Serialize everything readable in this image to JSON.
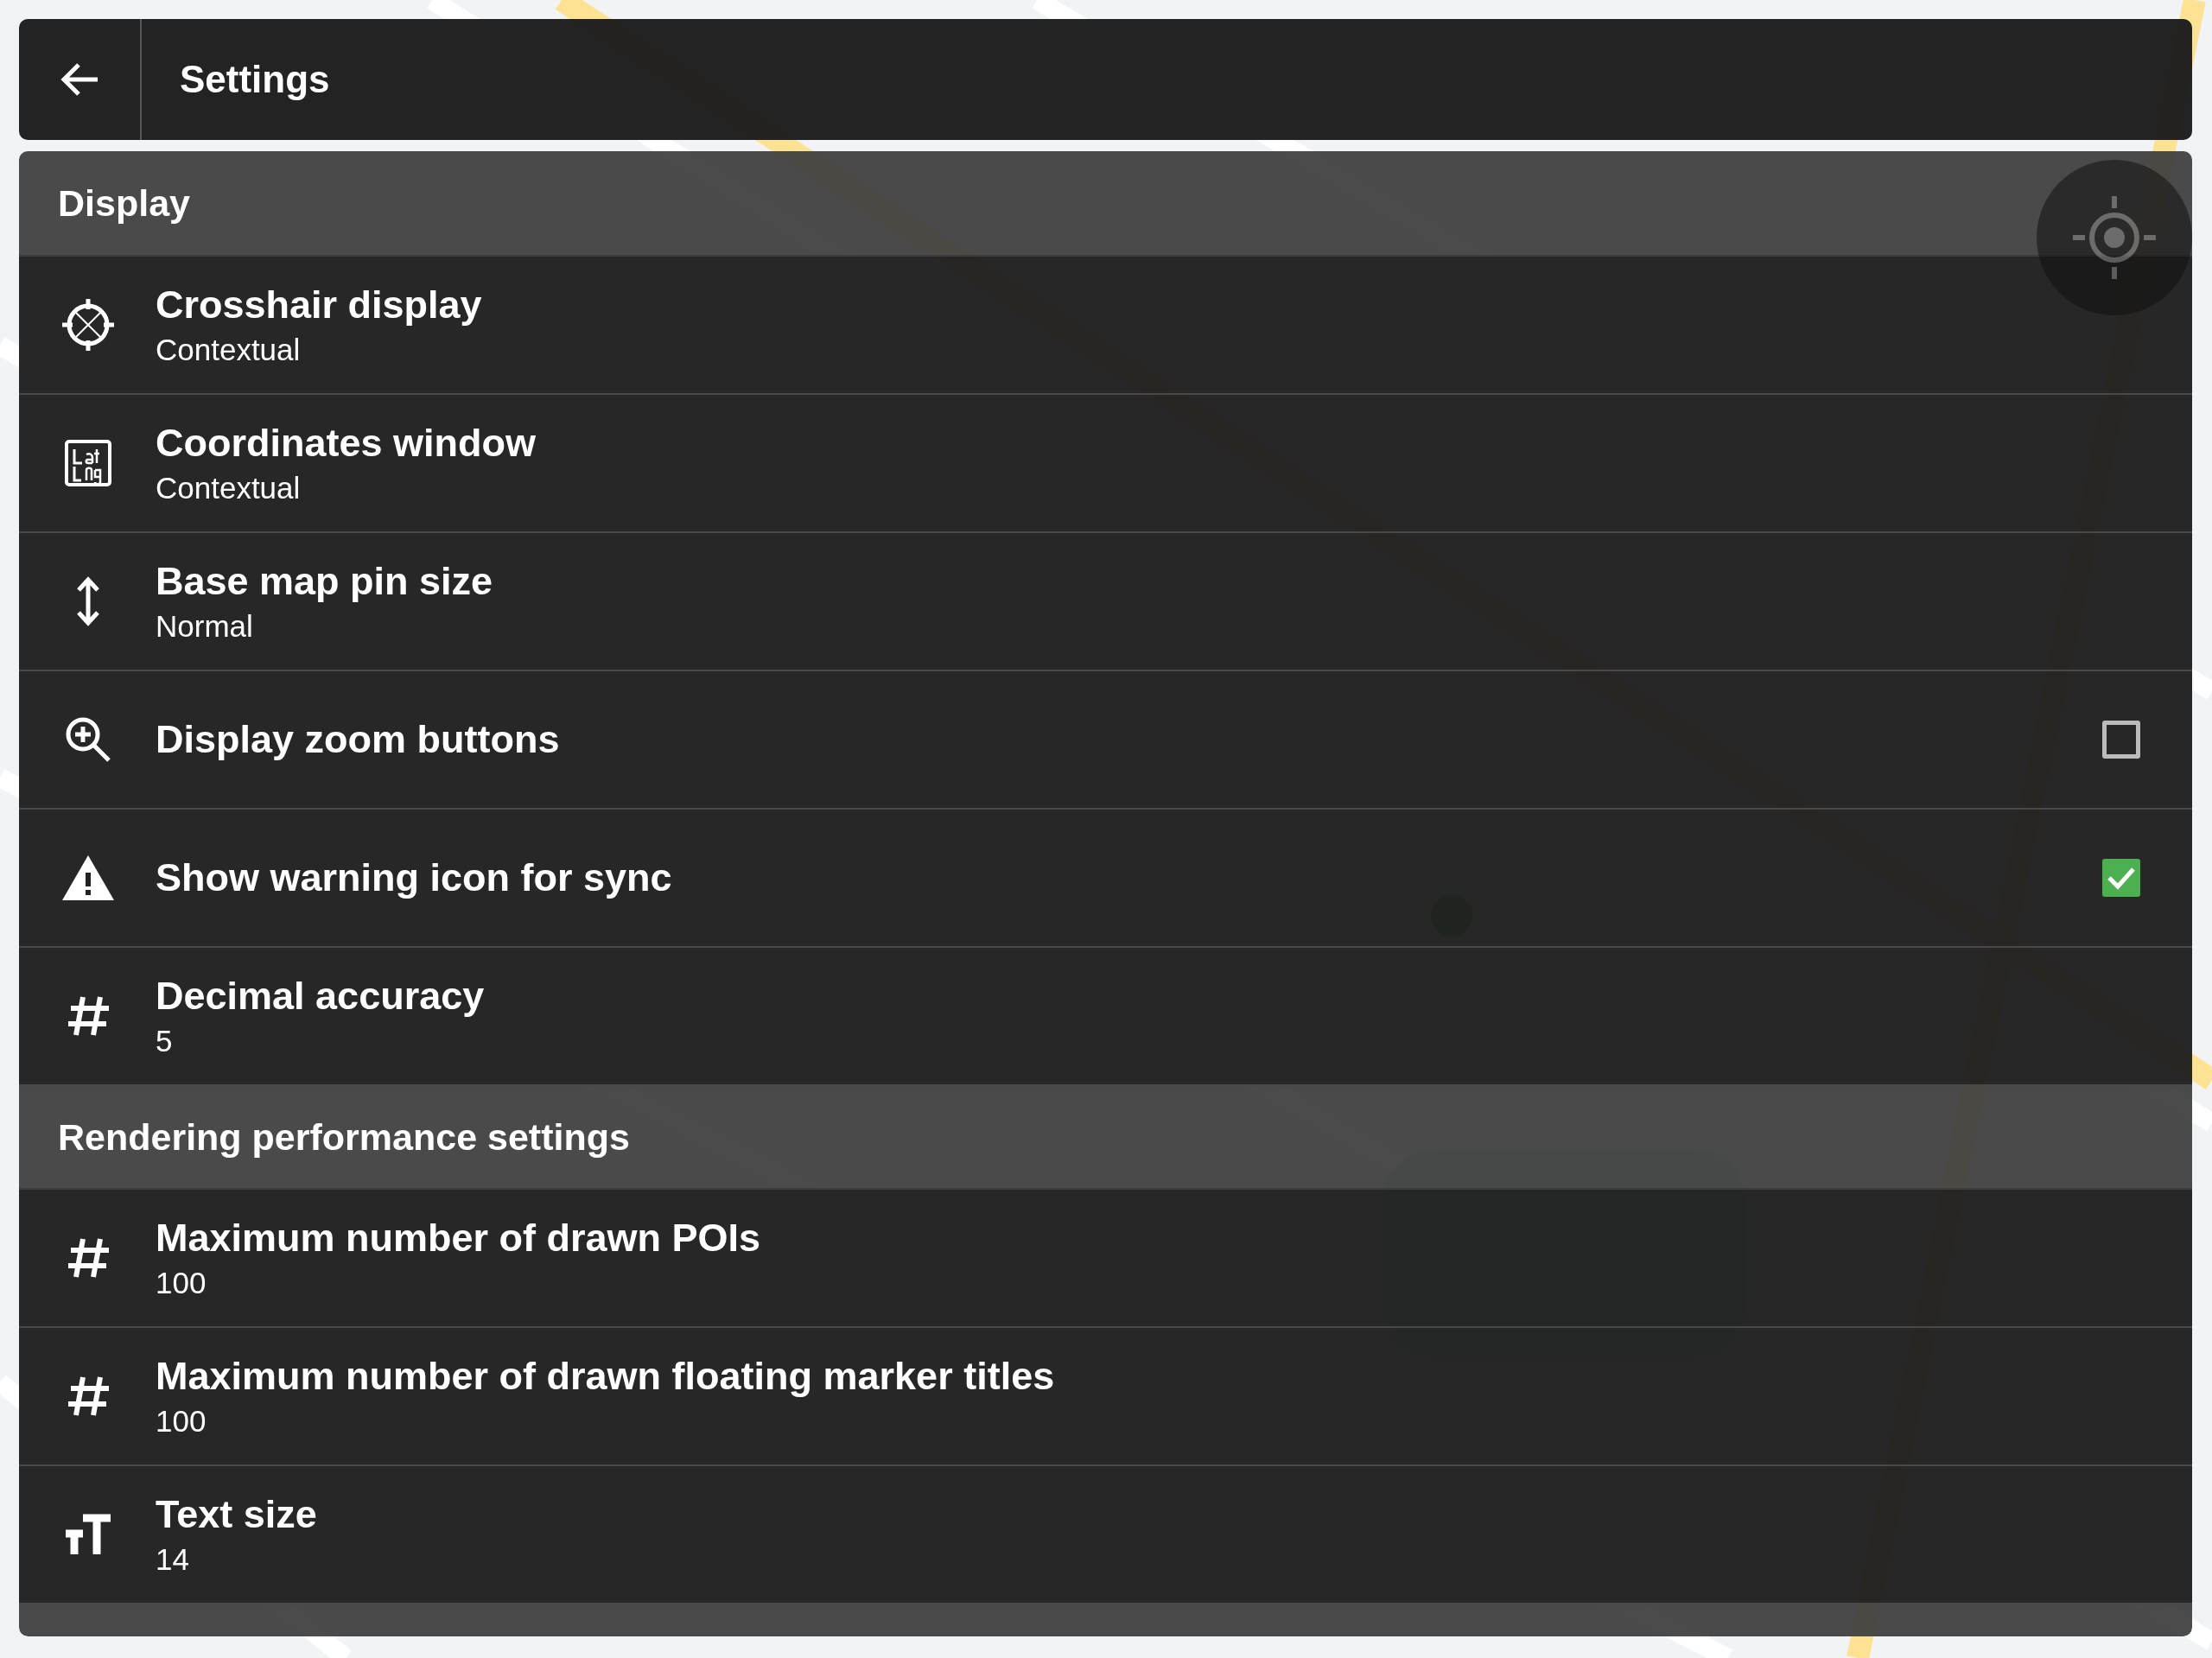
{
  "header": {
    "title": "Settings"
  },
  "sections": [
    {
      "title": "Display",
      "items": [
        {
          "kind": "value",
          "title": "Crosshair display",
          "value": "Contextual"
        },
        {
          "kind": "value",
          "title": "Coordinates window",
          "value": "Contextual"
        },
        {
          "kind": "value",
          "title": "Base map pin size",
          "value": "Normal"
        },
        {
          "kind": "toggle",
          "title": "Display zoom buttons",
          "checked": false
        },
        {
          "kind": "toggle",
          "title": "Show warning icon for sync",
          "checked": true
        },
        {
          "kind": "value",
          "title": "Decimal accuracy",
          "value": "5"
        }
      ]
    },
    {
      "title": "Rendering performance settings",
      "items": [
        {
          "kind": "value",
          "title": "Maximum number of drawn POIs",
          "value": "100"
        },
        {
          "kind": "value",
          "title": "Maximum number of drawn floating marker titles",
          "value": "100"
        },
        {
          "kind": "value",
          "title": "Text size",
          "value": "14"
        }
      ]
    }
  ]
}
